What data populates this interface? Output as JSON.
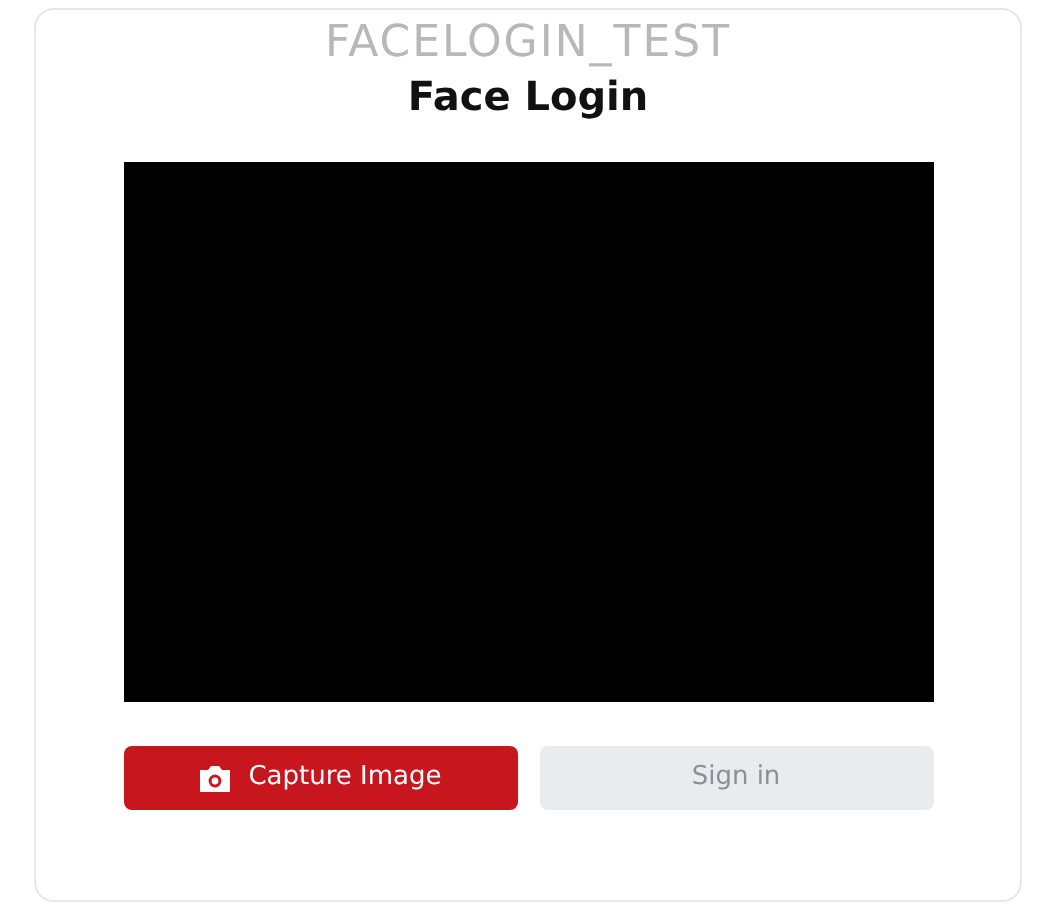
{
  "app_name": "FACELOGIN_TEST",
  "title": "Face Login",
  "buttons": [
    {
      "label": "Capture Image",
      "kind": "primary",
      "disabled": false
    },
    {
      "label": "Sign in",
      "kind": "secondary",
      "disabled": true
    }
  ]
}
